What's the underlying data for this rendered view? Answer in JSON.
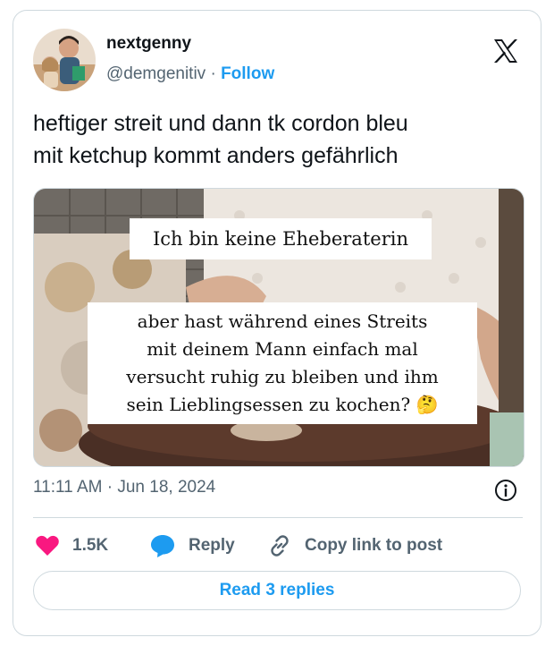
{
  "author": {
    "display_name": "nextgenny",
    "handle": "@demgenitiv",
    "separator": "·",
    "follow_label": "Follow"
  },
  "tweet": {
    "text_line1": "heftiger streit und dann tk cordon bleu",
    "text_line2": "mit ketchup kommt anders gefährlich"
  },
  "media": {
    "caption_top": "Ich bin keine Eheberaterin",
    "caption_lines": [
      "aber hast während eines Streits",
      "mit deinem Mann einfach mal",
      "versucht ruhig zu bleiben und ihm",
      "sein Lieblingsessen zu kochen? 🤔"
    ]
  },
  "timestamp": "11:11 AM · Jun 18, 2024",
  "actions": {
    "like_count": "1.5K",
    "reply_label": "Reply",
    "copy_label": "Copy link to post"
  },
  "read_replies_label": "Read 3 replies",
  "icons": {
    "logo": "x-logo-icon",
    "info": "info-icon",
    "like": "heart-icon",
    "reply": "speech-bubble-icon",
    "copy": "link-icon"
  },
  "colors": {
    "accent": "#1d9bf0",
    "heart": "#f91880",
    "secondary_text": "#536471",
    "border": "#cfd9de"
  }
}
